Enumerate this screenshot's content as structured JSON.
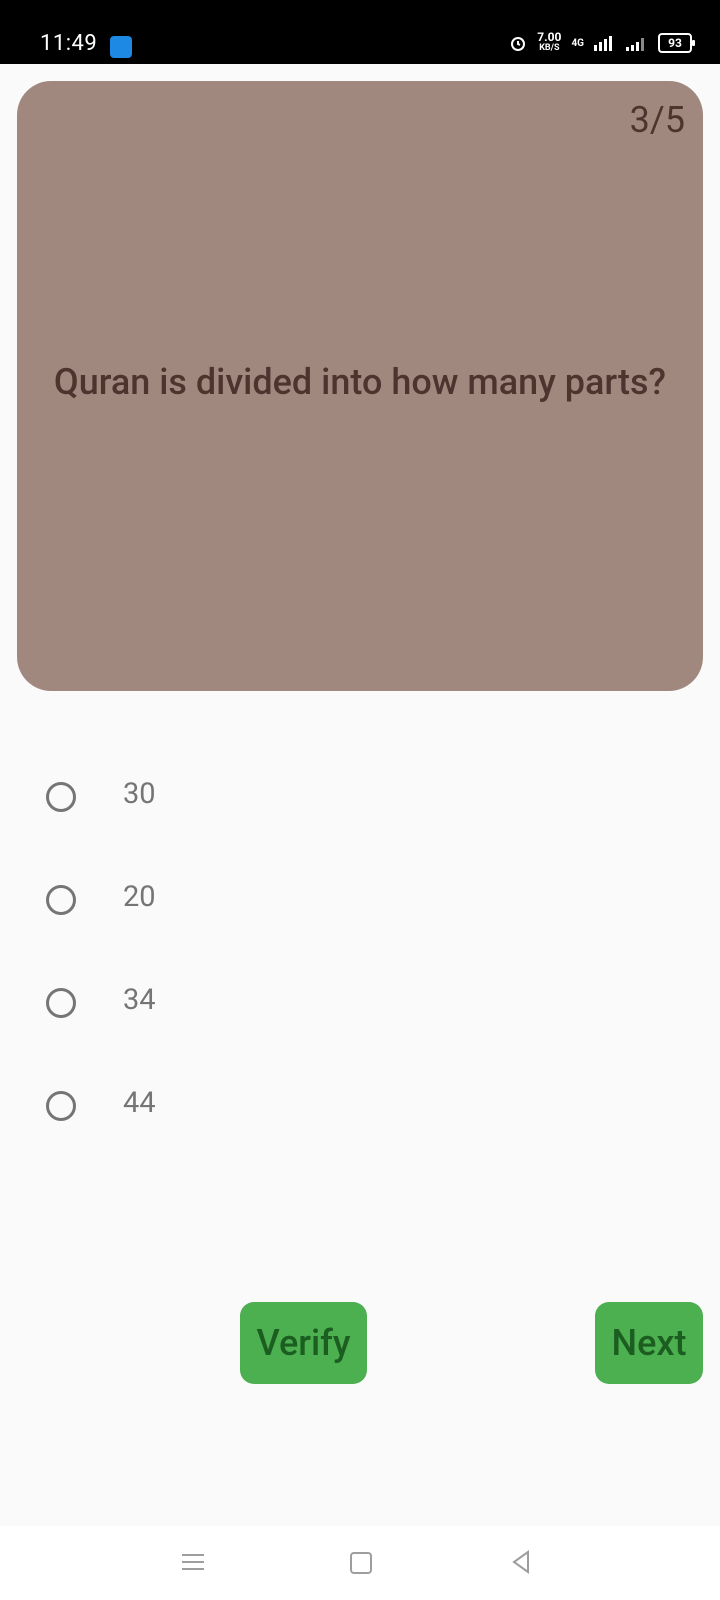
{
  "status": {
    "time": "11:49",
    "speed_value": "7.00",
    "speed_unit": "KB/S",
    "network": "4G",
    "battery": "93"
  },
  "quiz": {
    "counter": "3/5",
    "question": "Quran is divided into how many parts?",
    "options": [
      "30",
      "20",
      "34",
      "44"
    ],
    "verify_label": "Verify",
    "next_label": "Next"
  },
  "colors": {
    "card": "#a1887f",
    "card_text": "#4e342e",
    "button": "#4caf50",
    "button_text": "#1b5e20"
  },
  "icons": [
    "android-icon",
    "alarm-icon",
    "signal-icon",
    "battery-icon",
    "menu-icon",
    "home-icon",
    "back-icon"
  ]
}
